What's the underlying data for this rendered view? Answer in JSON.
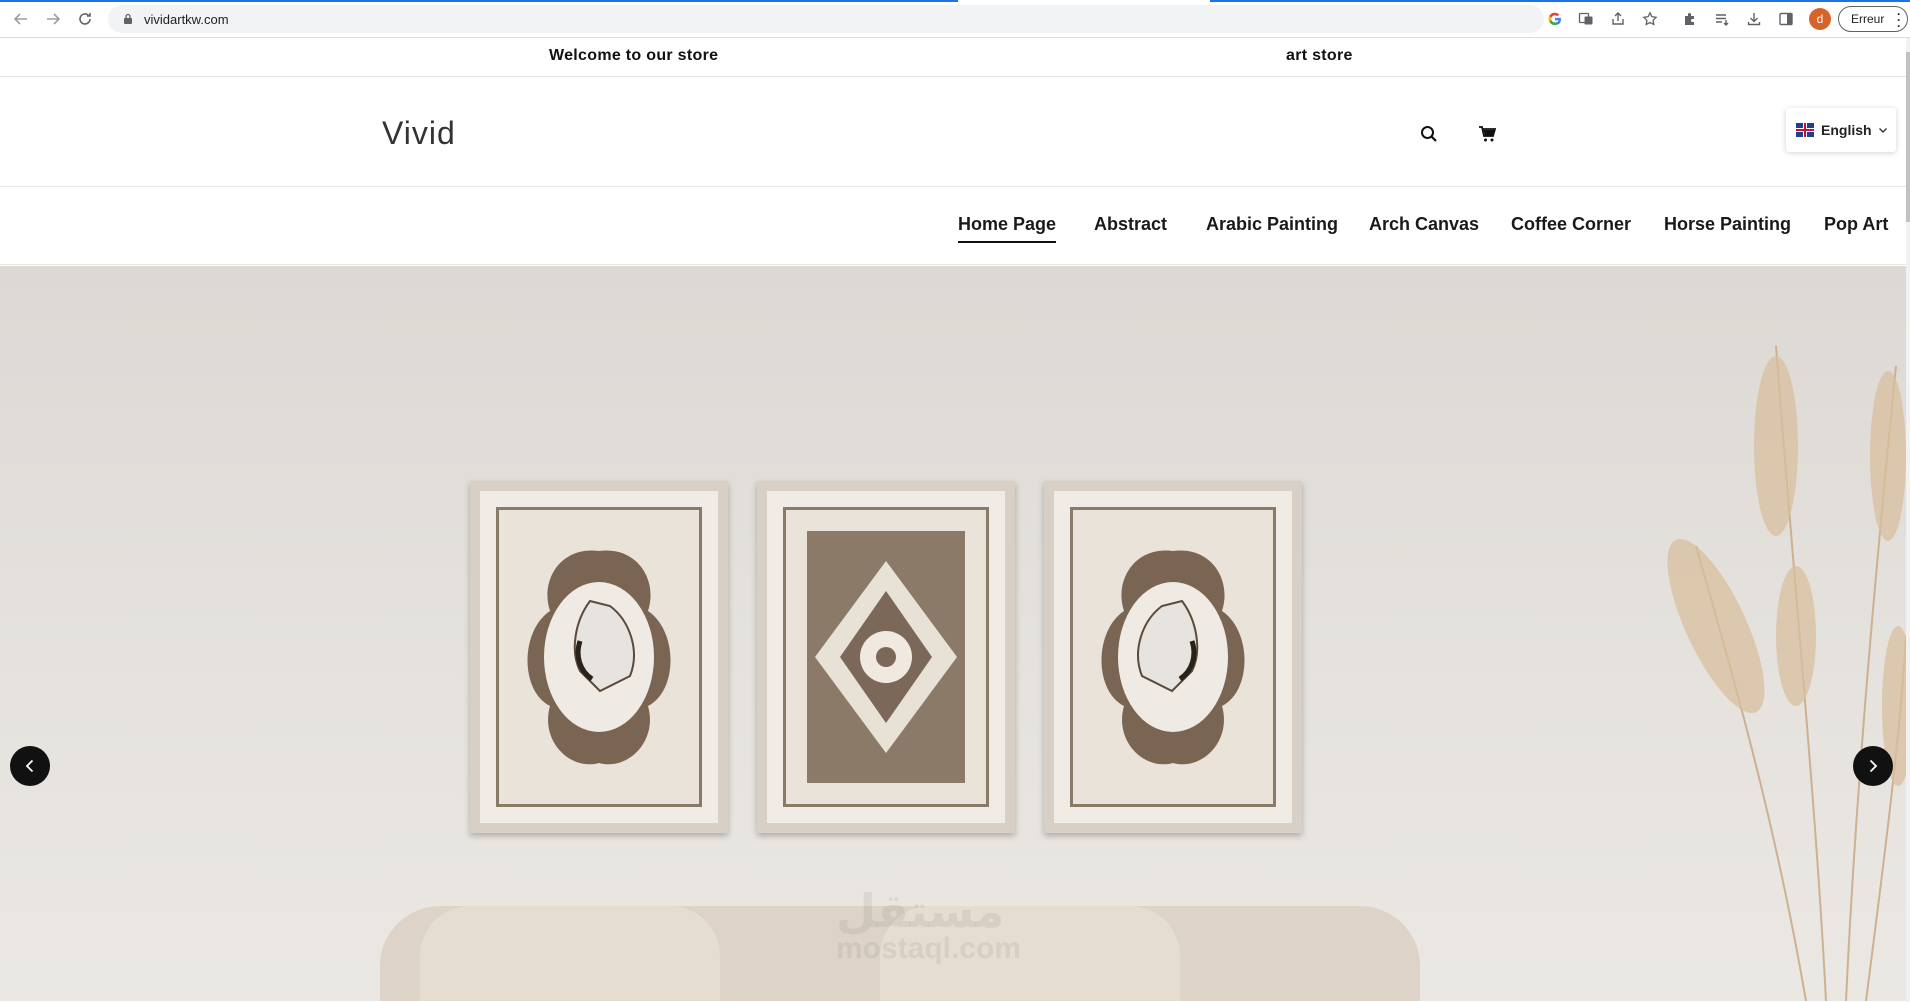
{
  "browser": {
    "url": "vividartkw.com",
    "profile_initial": "d",
    "error_label": "Erreur"
  },
  "announcement": {
    "left_text": "Welcome to our store",
    "right_text": "art store"
  },
  "header": {
    "logo": "Vivid",
    "language": "English"
  },
  "menu": {
    "items": [
      {
        "label": "Home Page",
        "active": true
      },
      {
        "label": "Abstract",
        "active": false
      },
      {
        "label": "Arabic Painting",
        "active": false
      },
      {
        "label": "Arch Canvas",
        "active": false
      },
      {
        "label": "Coffee Corner",
        "active": false
      },
      {
        "label": "Horse Painting",
        "active": false
      },
      {
        "label": "Pop Art",
        "active": false
      }
    ]
  },
  "hero": {
    "watermark_line1": "مستقل",
    "watermark_line2": "mostaql.com",
    "icons": {
      "prev": "chevron-left-icon",
      "next": "chevron-right-icon"
    }
  },
  "colors": {
    "accent": "#1a73e8",
    "arrow_bg": "#111111",
    "profile": "#d5632a"
  }
}
